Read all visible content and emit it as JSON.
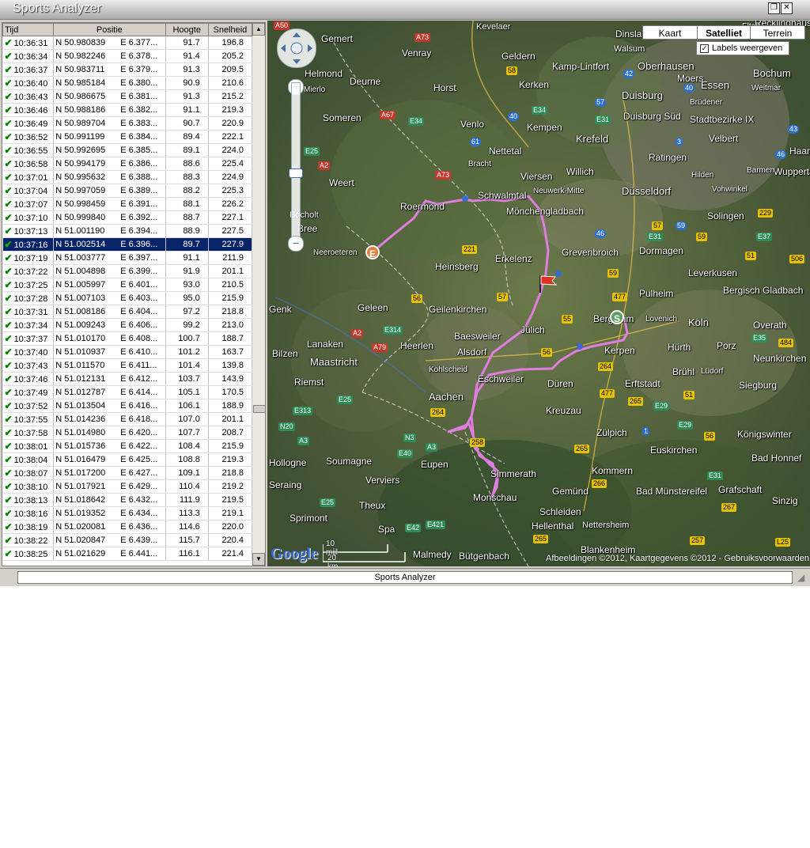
{
  "app": {
    "title": "Sports Analyzer",
    "status_text": "Sports Analyzer"
  },
  "columns": {
    "tijd": "Tijd",
    "positie": "Positie",
    "hoogte": "Hoogte",
    "snelheid": "Snelheid"
  },
  "rows": [
    {
      "t": "10:36:31",
      "lat": "N 50.980839",
      "lon": "E 6.377...",
      "h": "91.7",
      "s": "196.8"
    },
    {
      "t": "10:36:34",
      "lat": "N 50.982246",
      "lon": "E 6.378...",
      "h": "91.4",
      "s": "205.2"
    },
    {
      "t": "10:36:37",
      "lat": "N 50.983711",
      "lon": "E 6.379...",
      "h": "91.3",
      "s": "209.5"
    },
    {
      "t": "10:36:40",
      "lat": "N 50.985184",
      "lon": "E 6.380...",
      "h": "90.9",
      "s": "210.6"
    },
    {
      "t": "10:36:43",
      "lat": "N 50.986675",
      "lon": "E 6.381...",
      "h": "91.3",
      "s": "215.2"
    },
    {
      "t": "10:36:46",
      "lat": "N 50.988186",
      "lon": "E 6.382...",
      "h": "91.1",
      "s": "219.3"
    },
    {
      "t": "10:36:49",
      "lat": "N 50.989704",
      "lon": "E 6.383...",
      "h": "90.7",
      "s": "220.9"
    },
    {
      "t": "10:36:52",
      "lat": "N 50.991199",
      "lon": "E 6.384...",
      "h": "89.4",
      "s": "222.1"
    },
    {
      "t": "10:36:55",
      "lat": "N 50.992695",
      "lon": "E 6.385...",
      "h": "89.1",
      "s": "224.0"
    },
    {
      "t": "10:36:58",
      "lat": "N 50.994179",
      "lon": "E 6.386...",
      "h": "88.6",
      "s": "225.4"
    },
    {
      "t": "10:37:01",
      "lat": "N 50.995632",
      "lon": "E 6.388...",
      "h": "88.3",
      "s": "224.9"
    },
    {
      "t": "10:37:04",
      "lat": "N 50.997059",
      "lon": "E 6.389...",
      "h": "88.2",
      "s": "225.3"
    },
    {
      "t": "10:37:07",
      "lat": "N 50.998459",
      "lon": "E 6.391...",
      "h": "88.1",
      "s": "226.2"
    },
    {
      "t": "10:37:10",
      "lat": "N 50.999840",
      "lon": "E 6.392...",
      "h": "88.7",
      "s": "227.1"
    },
    {
      "t": "10:37:13",
      "lat": "N 51.001190",
      "lon": "E 6.394...",
      "h": "88.9",
      "s": "227.5"
    },
    {
      "t": "10:37:16",
      "lat": "N 51.002514",
      "lon": "E 6.396...",
      "h": "89.7",
      "s": "227.9",
      "selected": true
    },
    {
      "t": "10:37:19",
      "lat": "N 51.003777",
      "lon": "E 6.397...",
      "h": "91.1",
      "s": "211.9"
    },
    {
      "t": "10:37:22",
      "lat": "N 51.004898",
      "lon": "E 6.399...",
      "h": "91.9",
      "s": "201.1"
    },
    {
      "t": "10:37:25",
      "lat": "N 51.005997",
      "lon": "E 6.401...",
      "h": "93.0",
      "s": "210.5"
    },
    {
      "t": "10:37:28",
      "lat": "N 51.007103",
      "lon": "E 6.403...",
      "h": "95.0",
      "s": "215.9"
    },
    {
      "t": "10:37:31",
      "lat": "N 51.008186",
      "lon": "E 6.404...",
      "h": "97.2",
      "s": "218.8"
    },
    {
      "t": "10:37:34",
      "lat": "N 51.009243",
      "lon": "E 6.406...",
      "h": "99.2",
      "s": "213.0"
    },
    {
      "t": "10:37:37",
      "lat": "N 51.010170",
      "lon": "E 6.408...",
      "h": "100.7",
      "s": "188.7"
    },
    {
      "t": "10:37:40",
      "lat": "N 51.010937",
      "lon": "E 6.410...",
      "h": "101.2",
      "s": "163.7"
    },
    {
      "t": "10:37:43",
      "lat": "N 51.011570",
      "lon": "E 6.411...",
      "h": "101.4",
      "s": "139.8"
    },
    {
      "t": "10:37:46",
      "lat": "N 51.012131",
      "lon": "E 6.412...",
      "h": "103.7",
      "s": "143.9"
    },
    {
      "t": "10:37:49",
      "lat": "N 51.012787",
      "lon": "E 6.414...",
      "h": "105.1",
      "s": "170.5"
    },
    {
      "t": "10:37:52",
      "lat": "N 51.013504",
      "lon": "E 6.416...",
      "h": "106.1",
      "s": "188.9"
    },
    {
      "t": "10:37:55",
      "lat": "N 51.014236",
      "lon": "E 6.418...",
      "h": "107.0",
      "s": "201.1"
    },
    {
      "t": "10:37:58",
      "lat": "N 51.014980",
      "lon": "E 6.420...",
      "h": "107.7",
      "s": "208.7"
    },
    {
      "t": "10:38:01",
      "lat": "N 51.015736",
      "lon": "E 6.422...",
      "h": "108.4",
      "s": "215.9"
    },
    {
      "t": "10:38:04",
      "lat": "N 51.016479",
      "lon": "E 6.425...",
      "h": "108.8",
      "s": "219.3"
    },
    {
      "t": "10:38:07",
      "lat": "N 51.017200",
      "lon": "E 6.427...",
      "h": "109.1",
      "s": "218.8"
    },
    {
      "t": "10:38:10",
      "lat": "N 51.017921",
      "lon": "E 6.429...",
      "h": "110.4",
      "s": "219.2"
    },
    {
      "t": "10:38:13",
      "lat": "N 51.018642",
      "lon": "E 6.432...",
      "h": "111.9",
      "s": "219.5"
    },
    {
      "t": "10:38:16",
      "lat": "N 51.019352",
      "lon": "E 6.434...",
      "h": "113.3",
      "s": "219.1"
    },
    {
      "t": "10:38:19",
      "lat": "N 51.020081",
      "lon": "E 6.436...",
      "h": "114.6",
      "s": "220.0"
    },
    {
      "t": "10:38:22",
      "lat": "N 51.020847",
      "lon": "E 6.439...",
      "h": "115.7",
      "s": "220.4"
    },
    {
      "t": "10:38:25",
      "lat": "N 51.021629",
      "lon": "E 6.441...",
      "h": "116.1",
      "s": "221.4"
    }
  ],
  "map": {
    "types": [
      "Kaart",
      "Satelliet",
      "Terrein"
    ],
    "active_type": "Satelliet",
    "labels_checkbox": "Labels weergeven",
    "labels_checked": true,
    "scale_top": "10 mijl",
    "scale_bottom": "20 km",
    "google": "Google",
    "attribution": "Afbeeldingen ©2012, Kaartgegevens ©2012 - Gebruiksvoorwaarden",
    "start_marker": "S",
    "end_marker": "E",
    "track_color": "#e07ee0",
    "cities": [
      {
        "name": "Gemert"
      },
      {
        "name": "Venray"
      },
      {
        "name": "Geldern"
      },
      {
        "name": "Kamp-Lintfort"
      },
      {
        "name": "Oberhausen"
      },
      {
        "name": "Bochum"
      },
      {
        "name": "Helmond"
      },
      {
        "name": "Deurne"
      },
      {
        "name": "Horst"
      },
      {
        "name": "Moers"
      },
      {
        "name": "Duisburg"
      },
      {
        "name": "Essen"
      },
      {
        "name": "Kerken"
      },
      {
        "name": "Venlo"
      },
      {
        "name": "Kempen"
      },
      {
        "name": "Duisburg Süd"
      },
      {
        "name": "Stadtbezirke IX"
      },
      {
        "name": "Krefeld"
      },
      {
        "name": "Velbert"
      },
      {
        "name": "Nettetal"
      },
      {
        "name": "Ratingen"
      },
      {
        "name": "Weert"
      },
      {
        "name": "Viersen"
      },
      {
        "name": "Willich"
      },
      {
        "name": "Düsseldorf"
      },
      {
        "name": "Wuppertal"
      },
      {
        "name": "Roermond"
      },
      {
        "name": "Schwalmtal"
      },
      {
        "name": "Mönchengladbach"
      },
      {
        "name": "Solingen"
      },
      {
        "name": "Bree"
      },
      {
        "name": "Neeroeteren"
      },
      {
        "name": "Heinsberg"
      },
      {
        "name": "Erkelenz"
      },
      {
        "name": "Grevenbroich"
      },
      {
        "name": "Dormagen"
      },
      {
        "name": "Leverkusen"
      },
      {
        "name": "Pulheim"
      },
      {
        "name": "Bergisch Gladbach"
      },
      {
        "name": "Genk"
      },
      {
        "name": "Geleen"
      },
      {
        "name": "Geilenkirchen"
      },
      {
        "name": "Jülich"
      },
      {
        "name": "Bergheim"
      },
      {
        "name": "Köln"
      },
      {
        "name": "Baesweiler"
      },
      {
        "name": "Maastricht"
      },
      {
        "name": "Heerlen"
      },
      {
        "name": "Alsdorf"
      },
      {
        "name": "Kerpen"
      },
      {
        "name": "Hürth"
      },
      {
        "name": "Porz"
      },
      {
        "name": "Eschweiler"
      },
      {
        "name": "Düren"
      },
      {
        "name": "Erftstadt"
      },
      {
        "name": "Brühl"
      },
      {
        "name": "Siegburg"
      },
      {
        "name": "Aachen"
      },
      {
        "name": "Kreuzau"
      },
      {
        "name": "Zülpich"
      },
      {
        "name": "Euskirchen"
      },
      {
        "name": "Königswinter"
      },
      {
        "name": "Eupen"
      },
      {
        "name": "Soumagne"
      },
      {
        "name": "Verviers"
      },
      {
        "name": "Simmerath"
      },
      {
        "name": "Monschau"
      },
      {
        "name": "Schleiden"
      },
      {
        "name": "Hellenthal"
      },
      {
        "name": "Nettersheim"
      },
      {
        "name": "Bad Münstereifel"
      },
      {
        "name": "Grafschaft"
      },
      {
        "name": "Spa"
      },
      {
        "name": "Malmedy"
      },
      {
        "name": "Bütgenbach"
      },
      {
        "name": "Blankenheim"
      },
      {
        "name": "Bad Honnef"
      },
      {
        "name": "Lanaken"
      },
      {
        "name": "Bilzen"
      },
      {
        "name": "Riemst"
      },
      {
        "name": "Hollogne"
      },
      {
        "name": "Seraing"
      },
      {
        "name": "Theux"
      },
      {
        "name": "Sprimont"
      },
      {
        "name": "Gemünd"
      },
      {
        "name": "Kommern"
      },
      {
        "name": "Neunkirchen"
      },
      {
        "name": "Overath"
      },
      {
        "name": "Lovenich"
      },
      {
        "name": "Haan"
      },
      {
        "name": "Vohwinkel"
      },
      {
        "name": "Barmen"
      },
      {
        "name": "Hilden"
      },
      {
        "name": "Sinzig"
      },
      {
        "name": "Bocholt"
      },
      {
        "name": "Someren"
      },
      {
        "name": "Mierlo"
      },
      {
        "name": "Kohlscheid"
      },
      {
        "name": "Lüdorf"
      },
      {
        "name": "Walsum"
      },
      {
        "name": "Brüdener"
      },
      {
        "name": "Weitmar"
      },
      {
        "name": "Bracht"
      },
      {
        "name": "Neuwerk-Mitte"
      },
      {
        "name": "Recklinghausen"
      },
      {
        "name": "Dinsla"
      },
      {
        "name": "Kevelaer"
      },
      {
        "name": "Elten"
      }
    ]
  }
}
